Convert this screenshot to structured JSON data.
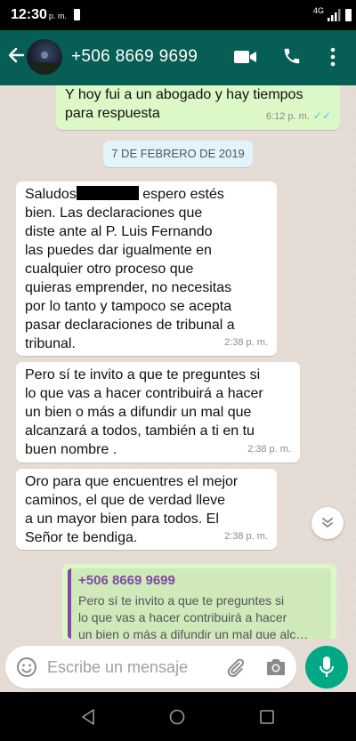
{
  "status_bar": {
    "time": "12:30",
    "ampm": "p. m.",
    "network": "4G"
  },
  "header": {
    "contact": "+506 8669 9699",
    "icons": [
      "back-arrow-icon",
      "video-call-icon",
      "voice-call-icon",
      "more-options-icon"
    ]
  },
  "messages": [
    {
      "direction": "out",
      "text": "Y hoy fui a un abogado y hay tiempos\npara respuesta",
      "time": "6:12 p. m.",
      "ticks": "✓✓",
      "tick_color": "#4fc3f7"
    },
    {
      "direction": "in",
      "text_before_redaction": "Saludos",
      "text_after_redaction": " espero estés\nbien.  Las declaraciones que\ndiste ante al P. Luis Fernando\nlas puedes dar igualmente en\ncualquier otro proceso que\nquieras emprender, no necesitas\npor lo tanto y tampoco se acepta\npasar declaraciones de tribunal a\ntribunal.",
      "time": "2:38 p. m."
    },
    {
      "direction": "in",
      "text": "Pero sí te invito a que te preguntes si\nlo que vas a hacer contribuirá a hacer\nun bien o más a difundir un mal que\nalcanzará a todos, también a ti en tu\nbuen nombre .",
      "time": "2:38 p. m."
    },
    {
      "direction": "in",
      "text": "Oro para que encuentres el mejor\ncaminos, el que de verdad lleve\na un mayor bien para todos. El\nSeñor te bendiga.",
      "time": "2:38 p. m."
    }
  ],
  "date_separator": "7 DE FEBRERO DE 2019",
  "reply_preview": {
    "author": "+506 8669 9699",
    "text": "Pero sí te invito a que te preguntes si\nlo que vas a hacer contribuirá a hacer\nun bien o más a difundir un mal que alc…"
  },
  "composer": {
    "placeholder": "Escribe un mensaje",
    "icons": [
      "emoji-icon",
      "attach-icon",
      "camera-icon",
      "mic-icon"
    ]
  },
  "colors": {
    "header": "#075e54",
    "outgoing_bubble": "#dcf8c6",
    "incoming_bubble": "#ffffff",
    "chat_background": "#e5ddd5",
    "mic_button": "#00a884",
    "quote_accent": "#7e4b9e"
  }
}
